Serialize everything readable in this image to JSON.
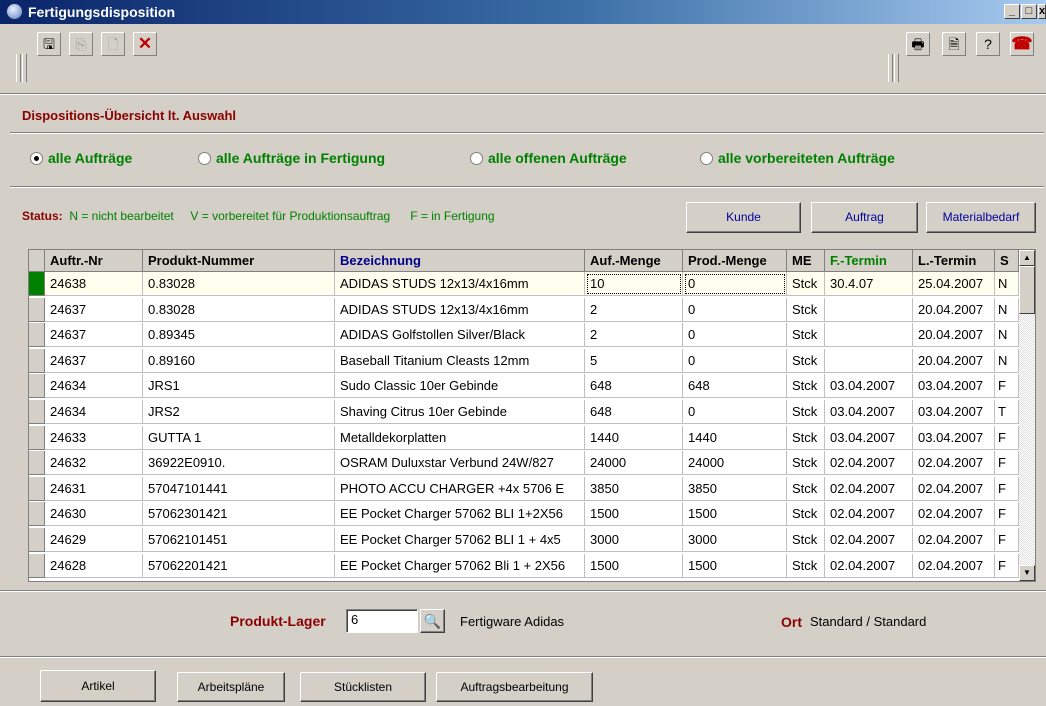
{
  "window": {
    "title": "Fertigungsdisposition",
    "controls": [
      "_",
      "□",
      "x"
    ]
  },
  "toolbar": {
    "left": [
      {
        "icon": "save-icon",
        "glyph": "🖫"
      },
      {
        "icon": "copy-icon",
        "glyph": "⎘"
      },
      {
        "icon": "new-document-icon",
        "glyph": "🗋"
      },
      {
        "icon": "delete-icon",
        "glyph": "✕"
      }
    ],
    "right": [
      {
        "icon": "print-icon",
        "glyph": "🖶"
      },
      {
        "icon": "print-preview-icon",
        "glyph": "🗎"
      },
      {
        "icon": "help-icon",
        "glyph": "?"
      },
      {
        "icon": "exit-icon",
        "glyph": "☎"
      }
    ]
  },
  "panel": {
    "heading": "Dispositions-Übersicht lt. Auswahl",
    "filters": [
      {
        "label": "alle Aufträge",
        "checked": true
      },
      {
        "label": "alle Aufträge in Fertigung",
        "checked": false
      },
      {
        "label": "alle offenen Aufträge",
        "checked": false
      },
      {
        "label": "alle vorbereiteten Aufträge",
        "checked": false
      }
    ],
    "status_label": "Status:",
    "status_text": "N = nicht bearbeitet     V = vorbereitet für Produktionsauftrag      F = in Fertigung",
    "buttons": {
      "kunde": "Kunde",
      "auftrag": "Auftrag",
      "materialbedarf": "Materialbedarf"
    }
  },
  "grid": {
    "columns": [
      "Auftr.-Nr",
      "Produkt-Nummer",
      "Bezeichnung",
      "Auf.-Menge",
      "Prod.-Menge",
      "ME",
      "F.-Termin",
      "L.-Termin",
      "S"
    ],
    "rows": [
      [
        "24638",
        "0.83028",
        "ADIDAS STUDS 12x13/4x16mm",
        "10",
        "0",
        "Stck",
        "30.4.07",
        "25.04.2007",
        "N"
      ],
      [
        "24637",
        "0.83028",
        "ADIDAS STUDS 12x13/4x16mm",
        "2",
        "0",
        "Stck",
        "",
        "20.04.2007",
        "N"
      ],
      [
        "24637",
        "0.89345",
        "ADIDAS Golfstollen Silver/Black",
        "2",
        "0",
        "Stck",
        "",
        "20.04.2007",
        "N"
      ],
      [
        "24637",
        "0.89160",
        "Baseball Titanium Cleasts 12mm",
        "5",
        "0",
        "Stck",
        "",
        "20.04.2007",
        "N"
      ],
      [
        "24634",
        "JRS1",
        "Sudo Classic 10er Gebinde",
        "648",
        "648",
        "Stck",
        "03.04.2007",
        "03.04.2007",
        "F"
      ],
      [
        "24634",
        "JRS2",
        "Shaving Citrus 10er Gebinde",
        "648",
        "0",
        "Stck",
        "03.04.2007",
        "03.04.2007",
        "T"
      ],
      [
        "24633",
        "GUTTA 1",
        "Metalldekorplatten",
        "1440",
        "1440",
        "Stck",
        "03.04.2007",
        "03.04.2007",
        "F"
      ],
      [
        "24632",
        "36922E0910.",
        "OSRAM Duluxstar Verbund 24W/827",
        "24000",
        "24000",
        "Stck",
        "02.04.2007",
        "02.04.2007",
        "F"
      ],
      [
        "24631",
        "57047101441",
        "PHOTO ACCU CHARGER +4x 5706 E",
        "3850",
        "3850",
        "Stck",
        "02.04.2007",
        "02.04.2007",
        "F"
      ],
      [
        "24630",
        "57062301421",
        "EE Pocket Charger 57062 BLI 1+2X56",
        "1500",
        "1500",
        "Stck",
        "02.04.2007",
        "02.04.2007",
        "F"
      ],
      [
        "24629",
        "57062101451",
        "EE Pocket Charger 57062 BLI 1 + 4x5",
        "3000",
        "3000",
        "Stck",
        "02.04.2007",
        "02.04.2007",
        "F"
      ],
      [
        "24628",
        "57062201421",
        "EE Pocket Charger 57062 Bli 1 + 2X56",
        "1500",
        "1500",
        "Stck",
        "02.04.2007",
        "02.04.2007",
        "F"
      ]
    ]
  },
  "stock": {
    "label": "Produkt-Lager",
    "value": "6",
    "description": "Fertigware Adidas",
    "ort_label": "Ort",
    "ort_value": "Standard / Standard"
  },
  "bottom_buttons": [
    "Artikel",
    "Arbeitspläne",
    "Stücklisten",
    "Auftragsbearbeitung"
  ],
  "colors": {
    "title_start": "#0a246a",
    "title_end": "#a6caf0",
    "accent_red": "#8b0000",
    "accent_green": "#008000",
    "link_blue": "#00009c"
  }
}
